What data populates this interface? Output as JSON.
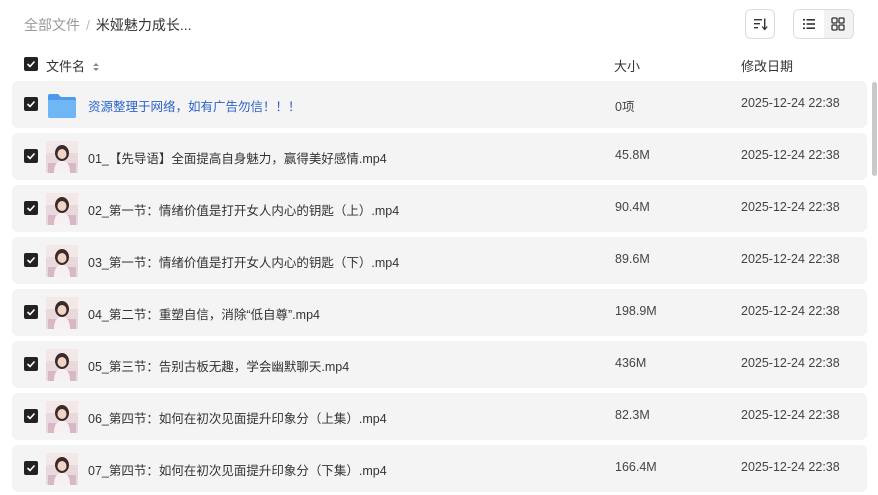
{
  "breadcrumb": {
    "root": "全部文件",
    "separator": "/",
    "current": "米娅魅力成长..."
  },
  "columns": {
    "name": "文件名",
    "size": "大小",
    "date": "修改日期"
  },
  "rows": [
    {
      "name": "资源整理于网络，如有广告勿信！！！",
      "size": "0项",
      "date": "2025-12-24 22:38",
      "type": "folder"
    },
    {
      "name": "01_【先导语】全面提高自身魅力，赢得美好感情.mp4",
      "size": "45.8M",
      "date": "2025-12-24 22:38",
      "type": "video"
    },
    {
      "name": "02_第一节：情绪价值是打开女人内心的钥匙（上）.mp4",
      "size": "90.4M",
      "date": "2025-12-24 22:38",
      "type": "video"
    },
    {
      "name": "03_第一节：情绪价值是打开女人内心的钥匙（下）.mp4",
      "size": "89.6M",
      "date": "2025-12-24 22:38",
      "type": "video"
    },
    {
      "name": "04_第二节：重塑自信，消除“低自尊”.mp4",
      "size": "198.9M",
      "date": "2025-12-24 22:38",
      "type": "video"
    },
    {
      "name": "05_第三节：告别古板无趣，学会幽默聊天.mp4",
      "size": "436M",
      "date": "2025-12-24 22:38",
      "type": "video"
    },
    {
      "name": "06_第四节：如何在初次见面提升印象分（上集）.mp4",
      "size": "82.3M",
      "date": "2025-12-24 22:38",
      "type": "video"
    },
    {
      "name": "07_第四节：如何在初次见面提升印象分（下集）.mp4",
      "size": "166.4M",
      "date": "2025-12-24 22:38",
      "type": "video"
    }
  ],
  "icons": {
    "sort": "sort-icon",
    "list_view": "list-view-icon",
    "grid_view": "grid-view-icon",
    "folder": "folder-icon",
    "checkbox": "checkbox-checked-icon",
    "sort_arrows": "sort-arrows-icon"
  },
  "colors": {
    "folder_link": "#2b63c7",
    "row_bg": "#f4f4f4",
    "checkbox": "#222222",
    "folder_icon": "#5aaaf0"
  }
}
